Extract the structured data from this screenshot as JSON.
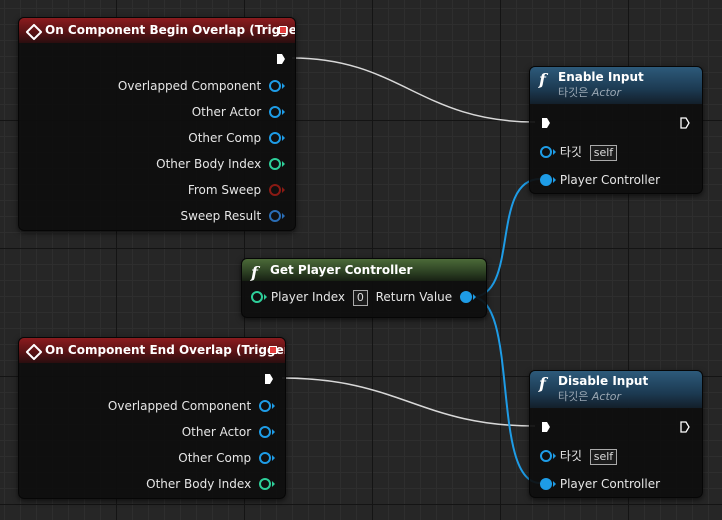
{
  "colors": {
    "object": "#1e9ce6",
    "int": "#2ecf9a",
    "struct": "#2a6db5",
    "bool": "#8a1a14",
    "exec": "#ffffff",
    "wire_exec": "#d8d8d8"
  },
  "begin_overlap": {
    "title": "On Component Begin Overlap (Trigger)",
    "pins": [
      "Overlapped Component",
      "Other Actor",
      "Other Comp",
      "Other Body Index",
      "From Sweep",
      "Sweep Result"
    ]
  },
  "end_overlap": {
    "title": "On Component End Overlap (Trigger)",
    "pins": [
      "Overlapped Component",
      "Other Actor",
      "Other Comp",
      "Other Body Index"
    ]
  },
  "enable_input": {
    "title": "Enable Input",
    "subtitle_prefix": "타깃은",
    "subtitle_type": "Actor",
    "target_label": "타깃",
    "target_value": "self",
    "controller_label": "Player Controller"
  },
  "disable_input": {
    "title": "Disable Input",
    "subtitle_prefix": "타깃은",
    "subtitle_type": "Actor",
    "target_label": "타깃",
    "target_value": "self",
    "controller_label": "Player Controller"
  },
  "get_player_controller": {
    "title": "Get Player Controller",
    "index_label": "Player Index",
    "index_value": "0",
    "return_label": "Return Value"
  },
  "icons": [
    "event-diamond-icon",
    "function-f-icon",
    "exec-pin-icon",
    "data-pin-icon",
    "stop-square-icon"
  ]
}
